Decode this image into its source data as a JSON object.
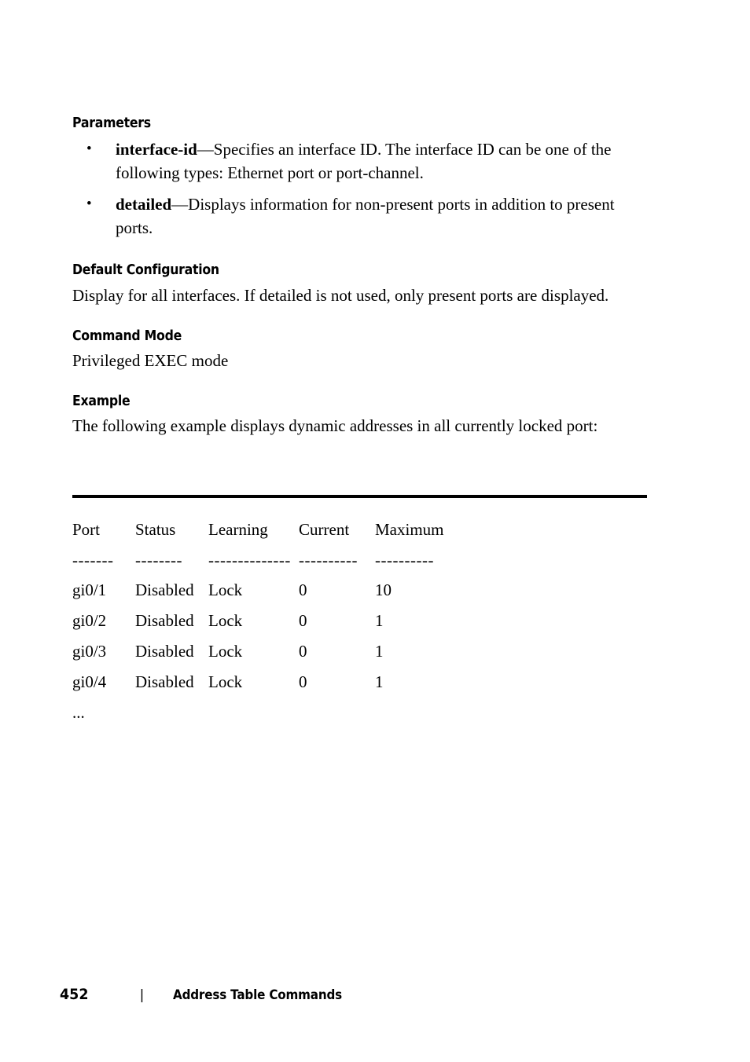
{
  "sections": {
    "parameters": {
      "heading": "Parameters",
      "items": [
        {
          "term": "interface-id",
          "description": "—Specifies an interface ID. The interface ID can be one of the following types: Ethernet port or port-channel.",
          "bullet": "•"
        },
        {
          "term": "detailed",
          "description": "—Displays information for non-present ports in addition to present ports.",
          "bullet": "•"
        }
      ]
    },
    "default_configuration": {
      "heading": "Default Configuration",
      "body": "Display for all interfaces. If detailed is not used, only present ports are displayed."
    },
    "command_mode": {
      "heading": "Command Mode",
      "body": "Privileged EXEC mode"
    },
    "example": {
      "heading": "Example",
      "body": "The following example displays dynamic addresses in all currently locked port:"
    }
  },
  "cli_output": {
    "headers": [
      "Port",
      "Status",
      "Learning",
      "Current",
      "Maximum"
    ],
    "separators": [
      "-------",
      "--------",
      "--------------",
      "----------",
      "----------"
    ],
    "rows": [
      [
        "gi0/1",
        "Disabled",
        "Lock",
        "0",
        "10"
      ],
      [
        "gi0/2",
        "Disabled",
        "Lock",
        "0",
        "1"
      ],
      [
        "gi0/3",
        "Disabled",
        "Lock",
        "0",
        "1"
      ],
      [
        "gi0/4",
        "Disabled",
        "Lock",
        "0",
        "1"
      ]
    ],
    "continuation": "..."
  },
  "footer": {
    "page_number": "452",
    "separator": "|",
    "chapter": "Address Table Commands"
  }
}
